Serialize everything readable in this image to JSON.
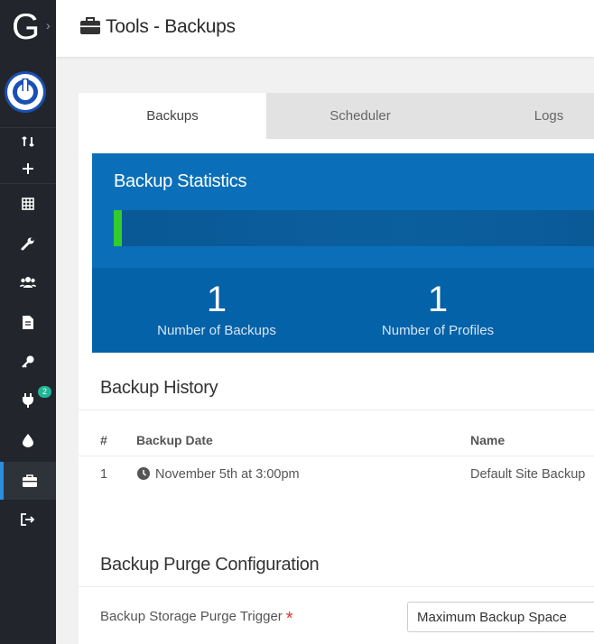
{
  "header": {
    "title": "Tools - Backups"
  },
  "sidebar": {
    "plugins_badge": "2"
  },
  "tabs": [
    {
      "label": "Backups",
      "active": true
    },
    {
      "label": "Scheduler",
      "active": false
    },
    {
      "label": "Logs",
      "active": false
    }
  ],
  "stats": {
    "title": "Backup Statistics",
    "progress_percent": 1.7,
    "items": [
      {
        "value": "1",
        "label": "Number of Backups"
      },
      {
        "value": "1",
        "label": "Number of Profiles"
      }
    ]
  },
  "history": {
    "title": "Backup History",
    "columns": [
      "#",
      "Backup Date",
      "Name"
    ],
    "rows": [
      {
        "num": "1",
        "date": "November 5th at 3:00pm",
        "name": "Default Site Backup"
      }
    ]
  },
  "purge": {
    "title": "Backup Purge Configuration",
    "trigger_label": "Backup Storage Purge Trigger",
    "required_mark": "*",
    "trigger_value": "Maximum Backup Space"
  },
  "colors": {
    "sidebar": "#22262c",
    "accent": "#2a8fe0",
    "stats_bg": "#0a6fb8",
    "progress": "#32cc2e",
    "badge": "#1fb596"
  }
}
